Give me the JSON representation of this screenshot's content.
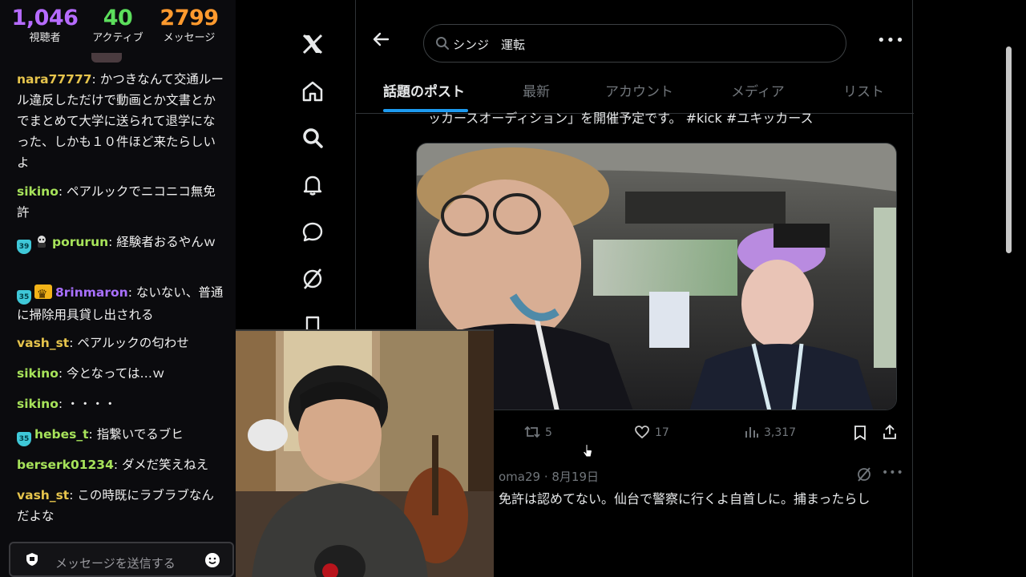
{
  "stream_stats": {
    "viewers": "1,046",
    "viewers_label": "視聴者",
    "active": "40",
    "active_label": "アクティブ",
    "messages": "2799",
    "messages_label": "メッセージ"
  },
  "chat": {
    "messages": [
      {
        "user": "nara77777",
        "text": "かつきなんて交通ルール違反しただけで動画とか文書とかでまとめて大学に送られて退学になった、しかも１０件ほど来たらしいよ",
        "color": "#e6c44c",
        "badge": ""
      },
      {
        "user": "sikino",
        "text": "ペアルックでニコニコ無免許",
        "color": "#a7e35a",
        "badge": ""
      },
      {
        "user": "porurun",
        "text": "経験者おるやんｗ",
        "color": "#a7e35a",
        "badge": "39"
      },
      {
        "user": "8rinmaron",
        "text": "ないない、普通に掃除用具貸し出される",
        "color": "#a970ff",
        "badge": "35"
      },
      {
        "user": "vash_st",
        "text": "ペアルックの匂わせ",
        "color": "#e6c44c",
        "badge": ""
      },
      {
        "user": "sikino",
        "text": "今となっては…ｗ",
        "color": "#a7e35a",
        "badge": ""
      },
      {
        "user": "sikino",
        "text": "・・・・",
        "color": "#a7e35a",
        "badge": ""
      },
      {
        "user": "hebes_t",
        "text": "指繋いでるブヒ",
        "color": "#a7e35a",
        "badge": "35"
      },
      {
        "user": "berserk01234",
        "text": "ダメだ笑えねえ",
        "color": "#a7e35a",
        "badge": ""
      },
      {
        "user": "vash_st",
        "text": "この時既にラブラブなんだよな",
        "color": "#e6c44c",
        "badge": ""
      }
    ],
    "input_placeholder": "メッセージを送信する"
  },
  "x": {
    "search_query": "シンジ　運転",
    "tabs": [
      "話題のポスト",
      "最新",
      "アカウント",
      "メディア",
      "リスト"
    ],
    "active_tab": "話題のポスト",
    "post": {
      "text_fragment": "ッカースオーディション」を開催予定です。 #kick #ユキッカース",
      "retweets": "5",
      "likes": "17",
      "views": "3,317"
    },
    "next_post": {
      "meta": "oma29 · 8月19日",
      "text": "免許は認めてない。仙台で警察に行くよ自首しに。捕まったらし"
    }
  },
  "icons": {
    "nav": [
      "x-logo-icon",
      "home-icon",
      "search-icon",
      "notifications-icon",
      "messages-icon",
      "grok-icon",
      "bookmarks-icon"
    ]
  },
  "colors": {
    "viewers": "#b66bff",
    "active": "#5cde5c",
    "messages": "#ff9a2e",
    "accent": "#1d9bf0"
  }
}
